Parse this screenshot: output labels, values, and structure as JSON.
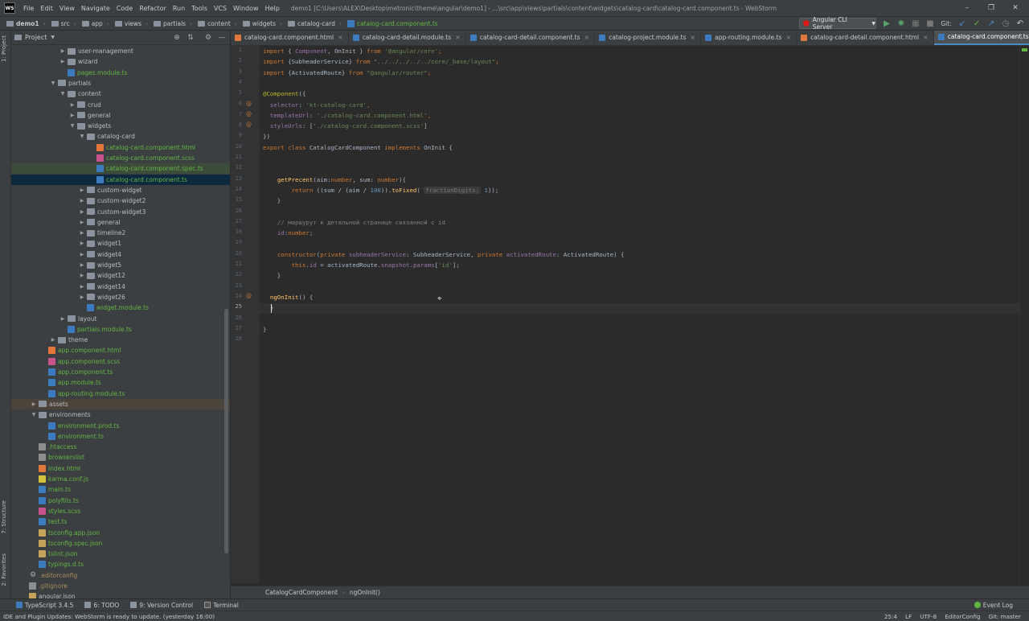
{
  "app": {
    "logo_text": "WS",
    "menu": [
      "File",
      "Edit",
      "View",
      "Navigate",
      "Code",
      "Refactor",
      "Run",
      "Tools",
      "VCS",
      "Window",
      "Help"
    ],
    "window_title": "demo1 [C:\\Users\\ALEX\\Desktop\\metronic\\theme\\angular\\demo1] - ...\\src\\app\\views\\partials\\content\\widgets\\catalog-card\\catalog-card.component.ts - WebStorm"
  },
  "navbar": {
    "crumbs": [
      "demo1",
      "src",
      "app",
      "views",
      "partials",
      "content",
      "widgets",
      "catalog-card",
      "catalog-card.component.ts"
    ],
    "run_config": "Angular CLI Server",
    "git_label": "Git:"
  },
  "side": {
    "project_tab": "1: Project",
    "structure_tab": "7: Structure",
    "favorites_tab": "2: Favorites"
  },
  "project": {
    "title": "Project",
    "tree": [
      {
        "label": "user-management",
        "indent": 5,
        "type": "folder",
        "arrow": "▶",
        "color": "def"
      },
      {
        "label": "wizard",
        "indent": 5,
        "type": "folder",
        "arrow": "▶",
        "color": "def"
      },
      {
        "label": "pages.module.ts",
        "indent": 5,
        "type": "ts",
        "arrow": "",
        "color": "green"
      },
      {
        "label": "partials",
        "indent": 4,
        "type": "folder",
        "arrow": "▼",
        "color": "def"
      },
      {
        "label": "content",
        "indent": 5,
        "type": "folder",
        "arrow": "▼",
        "color": "def"
      },
      {
        "label": "crud",
        "indent": 6,
        "type": "folder",
        "arrow": "▶",
        "color": "def"
      },
      {
        "label": "general",
        "indent": 6,
        "type": "folder",
        "arrow": "▶",
        "color": "def"
      },
      {
        "label": "widgets",
        "indent": 6,
        "type": "folder",
        "arrow": "▼",
        "color": "def"
      },
      {
        "label": "catalog-card",
        "indent": 7,
        "type": "folder",
        "arrow": "▼",
        "color": "def"
      },
      {
        "label": "catalog-card.component.html",
        "indent": 8,
        "type": "html",
        "arrow": "",
        "color": "green"
      },
      {
        "label": "catalog-card.component.scss",
        "indent": 8,
        "type": "scss",
        "arrow": "",
        "color": "green"
      },
      {
        "label": "catalog-card.component.spec.ts",
        "indent": 8,
        "type": "ts",
        "arrow": "",
        "color": "green",
        "highlight": "spec"
      },
      {
        "label": "catalog-card.component.ts",
        "indent": 8,
        "type": "ts",
        "arrow": "",
        "color": "green",
        "highlight": "selected"
      },
      {
        "label": "custom-widget",
        "indent": 7,
        "type": "folder",
        "arrow": "▶",
        "color": "def"
      },
      {
        "label": "custom-widget2",
        "indent": 7,
        "type": "folder",
        "arrow": "▶",
        "color": "def"
      },
      {
        "label": "custom-widget3",
        "indent": 7,
        "type": "folder",
        "arrow": "▶",
        "color": "def"
      },
      {
        "label": "general",
        "indent": 7,
        "type": "folder",
        "arrow": "▶",
        "color": "def"
      },
      {
        "label": "timeline2",
        "indent": 7,
        "type": "folder",
        "arrow": "▶",
        "color": "def"
      },
      {
        "label": "widget1",
        "indent": 7,
        "type": "folder",
        "arrow": "▶",
        "color": "def"
      },
      {
        "label": "widget4",
        "indent": 7,
        "type": "folder",
        "arrow": "▶",
        "color": "def"
      },
      {
        "label": "widget5",
        "indent": 7,
        "type": "folder",
        "arrow": "▶",
        "color": "def"
      },
      {
        "label": "widget12",
        "indent": 7,
        "type": "folder",
        "arrow": "▶",
        "color": "def"
      },
      {
        "label": "widget14",
        "indent": 7,
        "type": "folder",
        "arrow": "▶",
        "color": "def"
      },
      {
        "label": "widget26",
        "indent": 7,
        "type": "folder",
        "arrow": "▶",
        "color": "def"
      },
      {
        "label": "widget.module.ts",
        "indent": 7,
        "type": "ts",
        "arrow": "",
        "color": "green"
      },
      {
        "label": "layout",
        "indent": 5,
        "type": "folder",
        "arrow": "▶",
        "color": "def"
      },
      {
        "label": "partials.module.ts",
        "indent": 5,
        "type": "ts",
        "arrow": "",
        "color": "green"
      },
      {
        "label": "theme",
        "indent": 4,
        "type": "folder",
        "arrow": "▶",
        "color": "def"
      },
      {
        "label": "app.component.html",
        "indent": 3,
        "type": "html",
        "arrow": "",
        "color": "green"
      },
      {
        "label": "app.component.scss",
        "indent": 3,
        "type": "scss",
        "arrow": "",
        "color": "green"
      },
      {
        "label": "app.component.ts",
        "indent": 3,
        "type": "ts",
        "arrow": "",
        "color": "green"
      },
      {
        "label": "app.module.ts",
        "indent": 3,
        "type": "ts",
        "arrow": "",
        "color": "green"
      },
      {
        "label": "app-routing.module.ts",
        "indent": 3,
        "type": "ts",
        "arrow": "",
        "color": "green"
      },
      {
        "label": "assets",
        "indent": 2,
        "type": "folder",
        "arrow": "▶",
        "color": "def",
        "highlight": "assets"
      },
      {
        "label": "environments",
        "indent": 2,
        "type": "folder",
        "arrow": "▼",
        "color": "def"
      },
      {
        "label": "environment.prod.ts",
        "indent": 3,
        "type": "ts",
        "arrow": "",
        "color": "green"
      },
      {
        "label": "environment.ts",
        "indent": 3,
        "type": "ts",
        "arrow": "",
        "color": "green"
      },
      {
        "label": ".htaccess",
        "indent": 2,
        "type": "cfg",
        "arrow": "",
        "color": "green"
      },
      {
        "label": "browserslist",
        "indent": 2,
        "type": "cfg",
        "arrow": "",
        "color": "green"
      },
      {
        "label": "index.html",
        "indent": 2,
        "type": "html",
        "arrow": "",
        "color": "green"
      },
      {
        "label": "karma.conf.js",
        "indent": 2,
        "type": "js",
        "arrow": "",
        "color": "green"
      },
      {
        "label": "main.ts",
        "indent": 2,
        "type": "ts",
        "arrow": "",
        "color": "green"
      },
      {
        "label": "polyfills.ts",
        "indent": 2,
        "type": "ts",
        "arrow": "",
        "color": "green"
      },
      {
        "label": "styles.scss",
        "indent": 2,
        "type": "scss",
        "arrow": "",
        "color": "green"
      },
      {
        "label": "test.ts",
        "indent": 2,
        "type": "ts",
        "arrow": "",
        "color": "green"
      },
      {
        "label": "tsconfig.app.json",
        "indent": 2,
        "type": "json",
        "arrow": "",
        "color": "green"
      },
      {
        "label": "tsconfig.spec.json",
        "indent": 2,
        "type": "json",
        "arrow": "",
        "color": "green"
      },
      {
        "label": "tslint.json",
        "indent": 2,
        "type": "json",
        "arrow": "",
        "color": "green"
      },
      {
        "label": "typings.d.ts",
        "indent": 2,
        "type": "ts",
        "arrow": "",
        "color": "green"
      },
      {
        "label": ".editorconfig",
        "indent": 1,
        "type": "gear",
        "arrow": "",
        "color": "brown"
      },
      {
        "label": ".gitignore",
        "indent": 1,
        "type": "cfg",
        "arrow": "",
        "color": "brown"
      },
      {
        "label": "angular.json",
        "indent": 1,
        "type": "json",
        "arrow": "",
        "color": "def"
      }
    ]
  },
  "tabs": [
    {
      "label": "catalog-card.component.html",
      "type": "html"
    },
    {
      "label": "catalog-card-detail.module.ts",
      "type": "ts"
    },
    {
      "label": "catalog-card-detail.component.ts",
      "type": "ts"
    },
    {
      "label": "catalog-project.module.ts",
      "type": "ts"
    },
    {
      "label": "app-routing.module.ts",
      "type": "ts"
    },
    {
      "label": "catalog-card-detail.component.html",
      "type": "html"
    },
    {
      "label": "catalog-card.component.ts",
      "type": "ts",
      "active": true
    }
  ],
  "code": {
    "lines": [
      [
        [
          "k",
          "import"
        ],
        [
          "t",
          " { "
        ],
        [
          "p",
          "Component"
        ],
        [
          "t",
          ", OnInit } "
        ],
        [
          "k",
          "from"
        ],
        [
          "t",
          " "
        ],
        [
          "s",
          "'@angular/core'"
        ],
        [
          "k",
          ";"
        ]
      ],
      [
        [
          "k",
          "import"
        ],
        [
          "t",
          " {SubheaderService} "
        ],
        [
          "k",
          "from"
        ],
        [
          "t",
          " "
        ],
        [
          "s",
          "\"../../../../../core/_base/layout\""
        ],
        [
          "k",
          ";"
        ]
      ],
      [
        [
          "k",
          "import"
        ],
        [
          "t",
          " {ActivatedRoute} "
        ],
        [
          "k",
          "from"
        ],
        [
          "t",
          " "
        ],
        [
          "s",
          "\"@angular/router\""
        ],
        [
          "k",
          ";"
        ]
      ],
      [],
      [
        [
          "a",
          "@Component"
        ],
        [
          "t",
          "({"
        ]
      ],
      [
        [
          "t",
          "  "
        ],
        [
          "p",
          "selector"
        ],
        [
          "t",
          ": "
        ],
        [
          "s",
          "'kt-catalog-card'"
        ],
        [
          "k",
          ","
        ]
      ],
      [
        [
          "t",
          "  "
        ],
        [
          "p",
          "templateUrl"
        ],
        [
          "t",
          ": "
        ],
        [
          "s",
          "'./catalog-card.component.html'"
        ],
        [
          "k",
          ","
        ]
      ],
      [
        [
          "t",
          "  "
        ],
        [
          "p",
          "styleUrls"
        ],
        [
          "t",
          ": ["
        ],
        [
          "s",
          "'./catalog-card.component.scss'"
        ],
        [
          "t",
          "]"
        ]
      ],
      [
        [
          "t",
          "})"
        ]
      ],
      [
        [
          "k",
          "export class"
        ],
        [
          "t",
          " CatalogCardComponent "
        ],
        [
          "k",
          "implements"
        ],
        [
          "t",
          " OnInit {"
        ]
      ],
      [],
      [],
      [
        [
          "t",
          "    "
        ],
        [
          "f",
          "getPrecent"
        ],
        [
          "t",
          "(aim:"
        ],
        [
          "k",
          "number"
        ],
        [
          "t",
          ", sum: "
        ],
        [
          "k",
          "number"
        ],
        [
          "t",
          "){"
        ]
      ],
      [
        [
          "t",
          "        "
        ],
        [
          "k",
          "return"
        ],
        [
          "t",
          " ((sum / (aim / "
        ],
        [
          "n",
          "100"
        ],
        [
          "t",
          "))."
        ],
        [
          "f",
          "toFixed"
        ],
        [
          "t",
          "( "
        ],
        [
          "h",
          "fractionDigits:"
        ],
        [
          "t",
          " "
        ],
        [
          "n",
          "1"
        ],
        [
          "t",
          "));"
        ]
      ],
      [
        [
          "t",
          "    }"
        ]
      ],
      [],
      [
        [
          "t",
          "    "
        ],
        [
          "c",
          "// маршурут к детальной странице связанной с id"
        ]
      ],
      [
        [
          "t",
          "    "
        ],
        [
          "p",
          "id"
        ],
        [
          "t",
          ":"
        ],
        [
          "k",
          "number"
        ],
        [
          "t",
          ";"
        ]
      ],
      [],
      [
        [
          "t",
          "    "
        ],
        [
          "k",
          "constructor"
        ],
        [
          "t",
          "("
        ],
        [
          "k",
          "private"
        ],
        [
          "t",
          " "
        ],
        [
          "p",
          "subheaderService"
        ],
        [
          "t",
          ": SubheaderService, "
        ],
        [
          "k",
          "private"
        ],
        [
          "t",
          " "
        ],
        [
          "p",
          "activatedRoute"
        ],
        [
          "t",
          ": ActivatedRoute) {"
        ]
      ],
      [
        [
          "t",
          "        "
        ],
        [
          "k",
          "this"
        ],
        [
          "t",
          "."
        ],
        [
          "p",
          "id"
        ],
        [
          "t",
          " = activatedRoute."
        ],
        [
          "p",
          "snapshot"
        ],
        [
          "t",
          "."
        ],
        [
          "p",
          "params"
        ],
        [
          "t",
          "["
        ],
        [
          "s",
          "'id'"
        ],
        [
          "t",
          "];"
        ]
      ],
      [
        [
          "t",
          "    }"
        ]
      ],
      [],
      [
        [
          "t",
          "  "
        ],
        [
          "f",
          "ngOnInit"
        ],
        [
          "t",
          "() {"
        ]
      ],
      [
        [
          "t",
          "  }"
        ]
      ],
      [],
      [
        [
          "t",
          "}"
        ]
      ],
      []
    ],
    "gutter_marks": {
      "6": "@",
      "7": "@",
      "8": "@",
      "24": "@"
    }
  },
  "breadcrumb": [
    "CatalogCardComponent",
    "ngOnInit()"
  ],
  "toolwindows": [
    {
      "label": "TypeScript 3.4.5"
    },
    {
      "label": "6: TODO"
    },
    {
      "label": "9: Version Control"
    },
    {
      "label": "Terminal"
    }
  ],
  "event_log": "Event Log",
  "status": {
    "message": "IDE and Plugin Updates: WebStorm is ready to update. (yesterday 16:00)",
    "position": "25:4",
    "line_sep": "LF",
    "encoding": "UTF-8",
    "editorconfig": "EditorConfig",
    "git_branch": "Git: master"
  }
}
